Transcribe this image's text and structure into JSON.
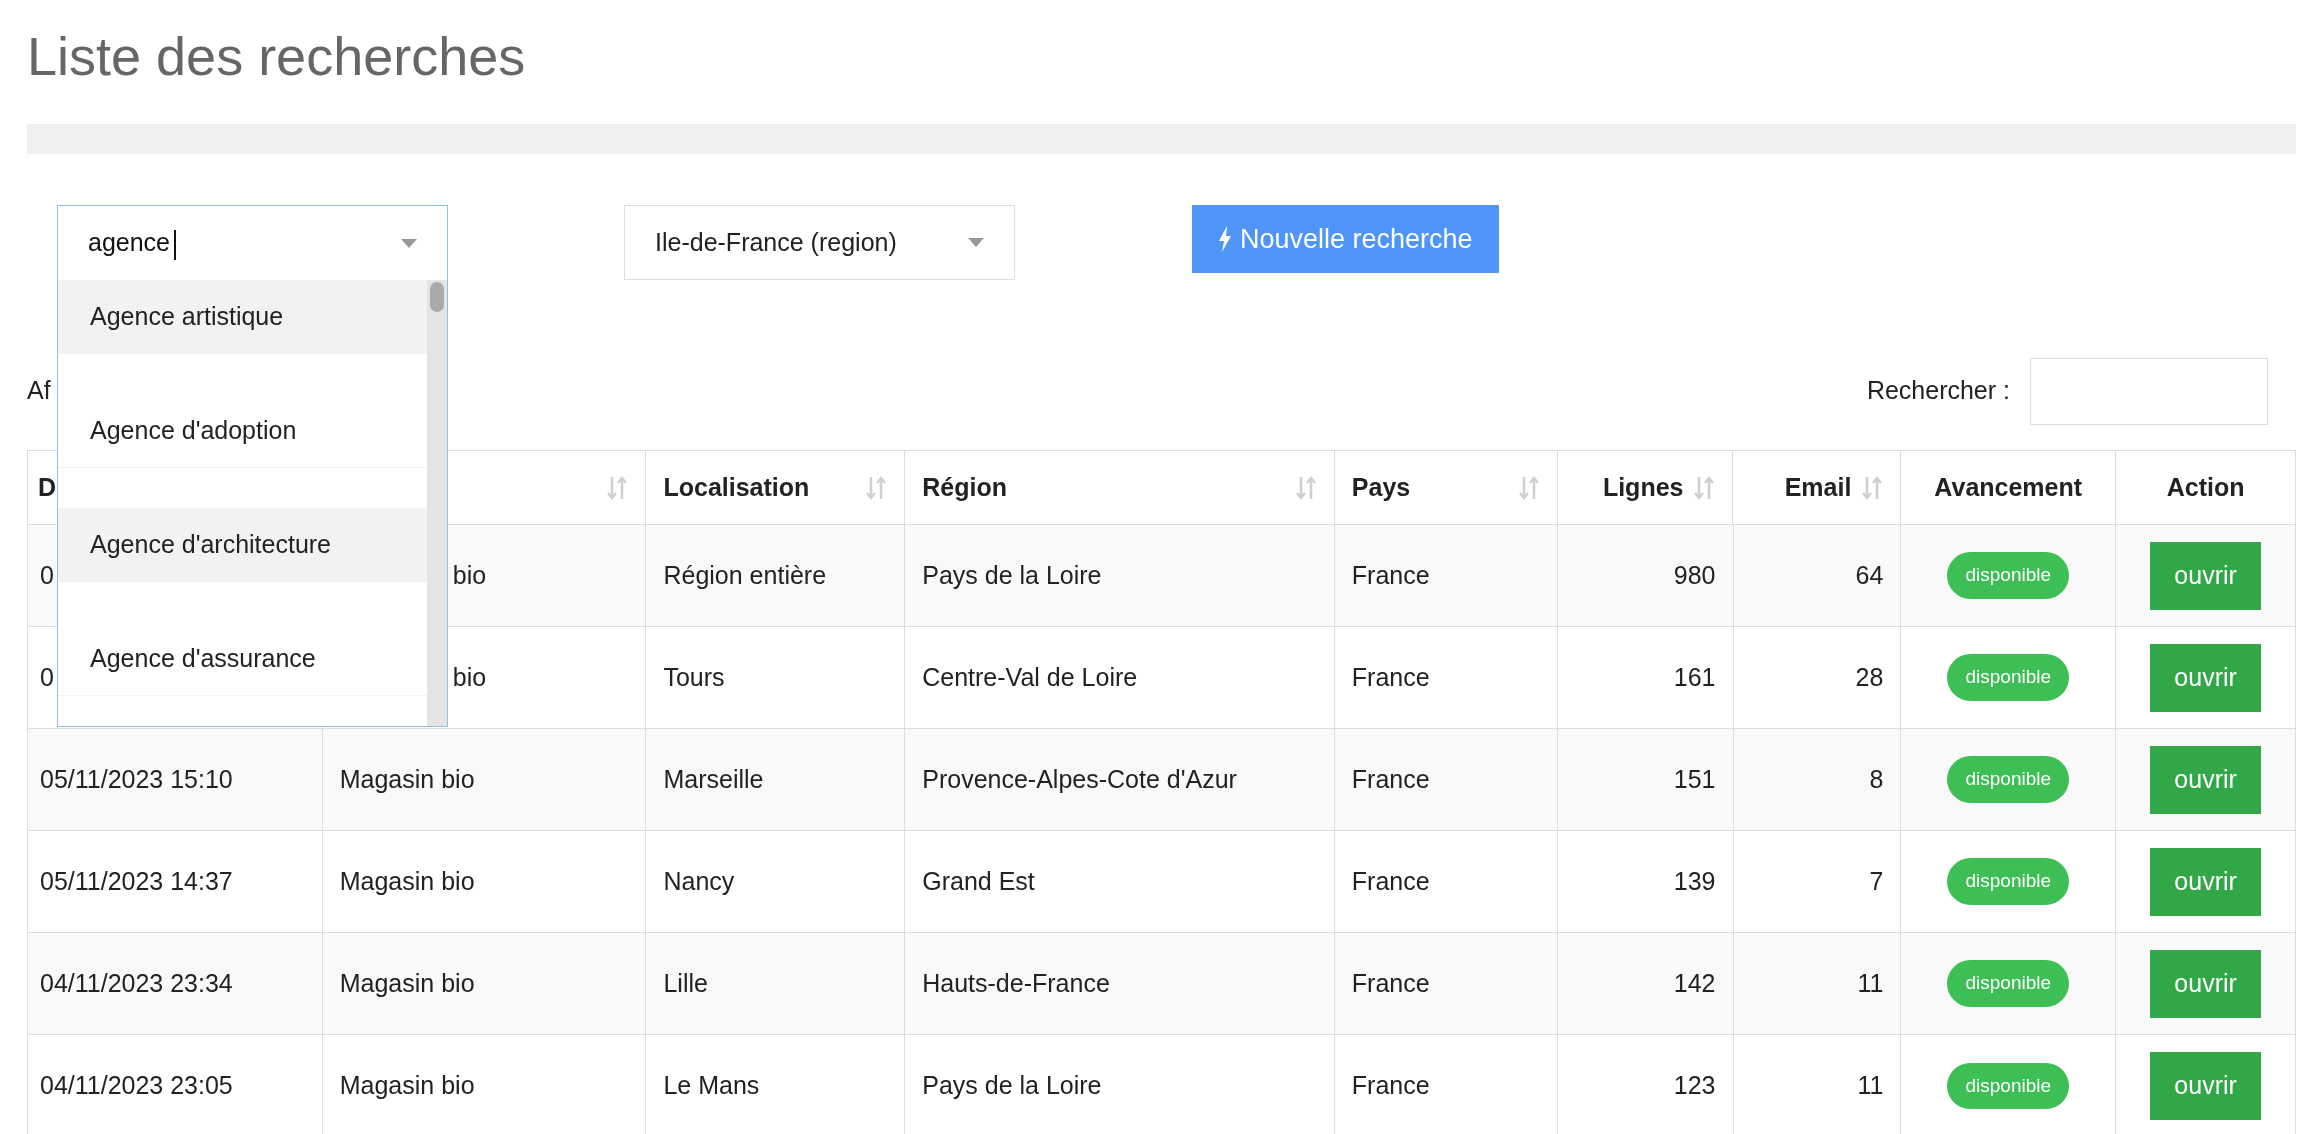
{
  "page_title": "Liste des recherches",
  "filters": {
    "activity": {
      "value": "agence",
      "expanded": true,
      "options": [
        {
          "label": "Agence artistique",
          "highlighted": true
        },
        {
          "label": "Agence d'adoption",
          "highlighted": false
        },
        {
          "label": "Agence d'architecture",
          "highlighted": true
        },
        {
          "label": "Agence d'assurance",
          "highlighted": false
        }
      ]
    },
    "region": {
      "value": "Ile-de-France (region)"
    },
    "new_search_button": "Nouvelle recherche"
  },
  "length_label": "Af",
  "search": {
    "label": "Rechercher :"
  },
  "table": {
    "columns": [
      {
        "label": "D"
      },
      {
        "sortable": true
      },
      {
        "label": "Localisation",
        "sortable": true
      },
      {
        "label": "Région",
        "sortable": true
      },
      {
        "label": "Pays",
        "sortable": true
      },
      {
        "label": "Lignes",
        "sortable": true
      },
      {
        "label": "Email",
        "sortable": true
      },
      {
        "label": "Avancement",
        "sortable": false
      },
      {
        "label": "Action",
        "sortable": false
      }
    ],
    "rows": [
      {
        "cells": [
          "0",
          "bio",
          "Région entière",
          "Pays de la Loire",
          "France",
          "980",
          "64"
        ],
        "status": "disponible",
        "action": "ouvrir"
      },
      {
        "cells": [
          "0",
          "bio",
          "Tours",
          "Centre-Val de Loire",
          "France",
          "161",
          "28"
        ],
        "status": "disponible",
        "action": "ouvrir"
      },
      {
        "cells": [
          "05/11/2023 15:10",
          "Magasin bio",
          "Marseille",
          "Provence-Alpes-Cote d'Azur",
          "France",
          "151",
          "8"
        ],
        "status": "disponible",
        "action": "ouvrir"
      },
      {
        "cells": [
          "05/11/2023 14:37",
          "Magasin bio",
          "Nancy",
          "Grand Est",
          "France",
          "139",
          "7"
        ],
        "status": "disponible",
        "action": "ouvrir"
      },
      {
        "cells": [
          "04/11/2023 23:34",
          "Magasin bio",
          "Lille",
          "Hauts-de-France",
          "France",
          "142",
          "11"
        ],
        "status": "disponible",
        "action": "ouvrir"
      },
      {
        "cells": [
          "04/11/2023 23:05",
          "Magasin bio",
          "Le Mans",
          "Pays de la Loire",
          "France",
          "123",
          "11"
        ],
        "status": "disponible",
        "action": "ouvrir"
      }
    ]
  }
}
